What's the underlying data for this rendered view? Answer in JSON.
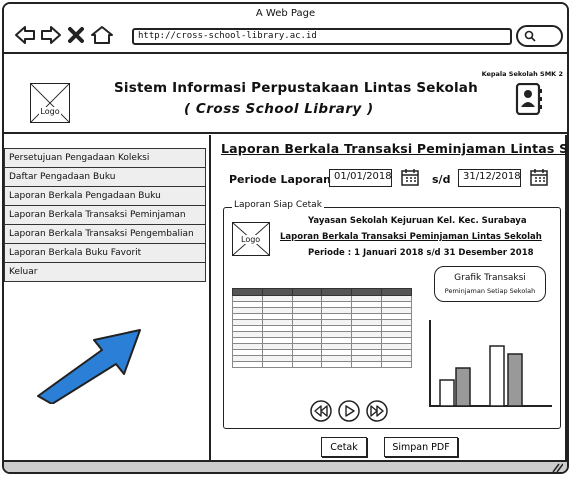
{
  "browser": {
    "window_title": "A Web Page",
    "url": "http://cross-school-library.ac.id"
  },
  "header": {
    "logo_label": "Logo",
    "title": "Sistem Informasi Perpustakaan Lintas Sekolah",
    "subtitle": "( Cross School Library )",
    "user_role": "Kepala Sekolah SMK 2"
  },
  "sidebar": {
    "items": [
      {
        "label": "Persetujuan Pengadaan Koleksi"
      },
      {
        "label": "Daftar Pengadaan Buku"
      },
      {
        "label": "Laporan Berkala Pengadaan Buku"
      },
      {
        "label": "Laporan Berkala Transaksi Peminjaman"
      },
      {
        "label": "Laporan Berkala Transaksi Pengembalian"
      },
      {
        "label": "Laporan Berkala Buku Favorit"
      },
      {
        "label": "Keluar"
      }
    ]
  },
  "main": {
    "title": "Laporan Berkala Transaksi Peminjaman Lintas Sekolah",
    "periode_label": "Periode Laporan",
    "date_from": "01/01/2018",
    "separator": "s/d",
    "date_to": "31/12/2018",
    "preview": {
      "legend": "Laporan Siap Cetak",
      "logo_label": "Logo",
      "line1": "Yayasan Sekolah Kejuruan Kel. Kec. Surabaya",
      "line2": "Laporan Berkala Transaksi Peminjaman Lintas Sekolah",
      "line3": "Periode : 1 Januari 2018 s/d 31 Desember 2018",
      "chart_title": "Grafik Transaksi",
      "chart_subtitle": "Peminjaman Setiap Sekolah"
    },
    "buttons": {
      "print": "Cetak",
      "save_pdf": "Simpan PDF"
    }
  }
}
